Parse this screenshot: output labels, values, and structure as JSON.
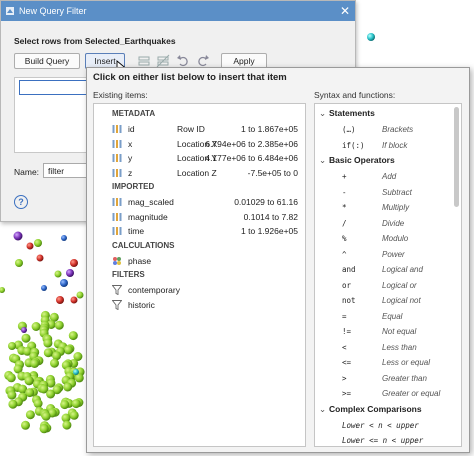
{
  "dialog": {
    "title": "New Query Filter",
    "close_glyph": "✕",
    "section_label": "Select rows from Selected_Earthquakes",
    "build_query_label": "Build Query",
    "insert_label": "Insert",
    "apply_label": "Apply",
    "name_label": "Name:",
    "name_value": "filter",
    "help_glyph": "?"
  },
  "popup": {
    "title": "Click on either list below to insert that item",
    "existing_label": "Existing items:",
    "syntax_label": "Syntax and functions:",
    "groups": [
      {
        "title": "METADATA",
        "items": [
          {
            "icon": "column-icon",
            "name": "id",
            "desc": "Row ID",
            "range": "1 to 1.867e+05"
          },
          {
            "icon": "column-icon",
            "name": "x",
            "desc": "Location X",
            "range": "6.794e+06 to 2.385e+06"
          },
          {
            "icon": "column-icon",
            "name": "y",
            "desc": "Location Y",
            "range": "4.177e+06 to 6.484e+06"
          },
          {
            "icon": "column-icon",
            "name": "z",
            "desc": "Location Z",
            "range": "-7.5e+05 to 0"
          }
        ]
      },
      {
        "title": "IMPORTED",
        "items": [
          {
            "icon": "column-icon",
            "name": "mag_scaled",
            "desc": "",
            "range": "0.01029 to 61.16"
          },
          {
            "icon": "column-icon",
            "name": "magnitude",
            "desc": "",
            "range": "0.1014 to 7.82"
          },
          {
            "icon": "column-icon",
            "name": "time",
            "desc": "",
            "range": "1 to 1.926e+05"
          }
        ]
      },
      {
        "title": "CALCULATIONS",
        "items": [
          {
            "icon": "category-icon",
            "name": "phase",
            "desc": "",
            "range": ""
          }
        ]
      },
      {
        "title": "FILTERS",
        "items": [
          {
            "icon": "filter-icon",
            "name": "contemporary",
            "desc": "",
            "range": ""
          },
          {
            "icon": "filter-icon",
            "name": "historic",
            "desc": "",
            "range": ""
          }
        ]
      }
    ],
    "syntax": [
      {
        "heading": "Statements",
        "rows": [
          {
            "code": "(…)",
            "text": "Brackets"
          },
          {
            "code": "if(:)",
            "text": "If block"
          }
        ]
      },
      {
        "heading": "Basic Operators",
        "rows": [
          {
            "code": "+",
            "text": "Add"
          },
          {
            "code": "-",
            "text": "Subtract"
          },
          {
            "code": "*",
            "text": "Multiply"
          },
          {
            "code": "/",
            "text": "Divide"
          },
          {
            "code": "%",
            "text": "Modulo"
          },
          {
            "code": "^",
            "text": "Power"
          },
          {
            "code": "and",
            "text": "Logical and"
          },
          {
            "code": "or",
            "text": "Logical or"
          },
          {
            "code": "not",
            "text": "Logical not"
          },
          {
            "code": "=",
            "text": "Equal"
          },
          {
            "code": "!=",
            "text": "Not equal"
          },
          {
            "code": "<",
            "text": "Less than"
          },
          {
            "code": "<=",
            "text": "Less or equal"
          },
          {
            "code": ">",
            "text": "Greater than"
          },
          {
            "code": ">=",
            "text": "Greater or equal"
          }
        ]
      },
      {
        "heading": "Complex Comparisons",
        "rows": [
          {
            "code": "Lower < n < upper",
            "text": "",
            "wide": true
          },
          {
            "code": "Lower <= n < upper",
            "text": "",
            "wide": true
          }
        ]
      }
    ]
  },
  "colors": {
    "titlebar": "#5b8fc7",
    "accent": "#3b70c0",
    "sphere_green": "#8ed12e",
    "sphere_red": "#d2312a",
    "sphere_blue": "#2e66c8",
    "sphere_cyan": "#29c3c9",
    "sphere_purple": "#7a32b8"
  }
}
